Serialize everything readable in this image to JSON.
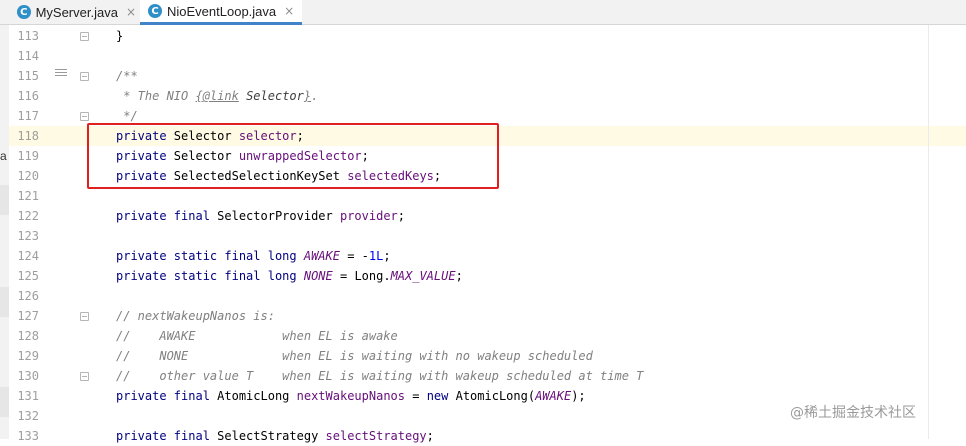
{
  "tabs": [
    {
      "name": "MyServer.java",
      "icon": "java-class-icon",
      "icon_letter": "C",
      "active": false
    },
    {
      "name": "NioEventLoop.java",
      "icon": "java-class-icon",
      "icon_letter": "C",
      "active": true
    }
  ],
  "close_glyph": "×",
  "side_fragment": "a",
  "colors": {
    "keyword": "#000080",
    "field": "#660e7a",
    "number": "#0000ff",
    "comment": "#808080",
    "current_line": "#fffae3",
    "highlight_box": "#e01f1f",
    "active_tab_underline": "#4083c9"
  },
  "editor": {
    "line_numbers": [
      "113",
      "114",
      "115",
      "116",
      "117",
      "118",
      "119",
      "120",
      "121",
      "122",
      "123",
      "124",
      "125",
      "126",
      "127",
      "128",
      "129",
      "130",
      "131",
      "132",
      "133"
    ],
    "current_line_number": "118",
    "lines": {
      "l113": {
        "t": "}"
      },
      "l115": {
        "t": "/**"
      },
      "l116": {
        "pre": " * The NIO ",
        "lb": "{",
        "tag": "@link",
        "ref": " Selector",
        "rb": "}",
        "post": "."
      },
      "l117": {
        "t": " */"
      },
      "l118": {
        "kw": "private",
        "type": " Selector ",
        "name": "selector",
        "end": ";"
      },
      "l119": {
        "kw": "private",
        "type": " Selector ",
        "name": "unwrappedSelector",
        "end": ";"
      },
      "l120": {
        "kw": "private",
        "type": " SelectedSelectionKeySet ",
        "name": "selectedKeys",
        "end": ";"
      },
      "l122": {
        "kw": "private final",
        "type": " SelectorProvider ",
        "name": "provider",
        "end": ";"
      },
      "l124": {
        "kw": "private static final long",
        "sp": " ",
        "name": "AWAKE",
        "eq": " = -",
        "num": "1L",
        "end": ";"
      },
      "l125": {
        "kw": "private static final long",
        "sp": " ",
        "name": "NONE",
        "eq": " = Long.",
        "cst": "MAX_VALUE",
        "end": ";"
      },
      "l127": {
        "t": "// nextWakeupNanos is:"
      },
      "l128": {
        "t": "//    AWAKE            when EL is awake"
      },
      "l129": {
        "t": "//    NONE             when EL is waiting with no wakeup scheduled"
      },
      "l130": {
        "t": "//    other value T    when EL is waiting with wakeup scheduled at time T"
      },
      "l131": {
        "kw": "private final",
        "type": " AtomicLong ",
        "name": "nextWakeupNanos",
        "eq": " = ",
        "kw2": "new",
        "call": " AtomicLong(",
        "arg": "AWAKE",
        "end": ");"
      },
      "l133": {
        "kw": "private final",
        "type": " SelectStrategy ",
        "name": "selectStrategy",
        "end": ";"
      }
    }
  },
  "watermark": "@稀土掘金技术社区"
}
